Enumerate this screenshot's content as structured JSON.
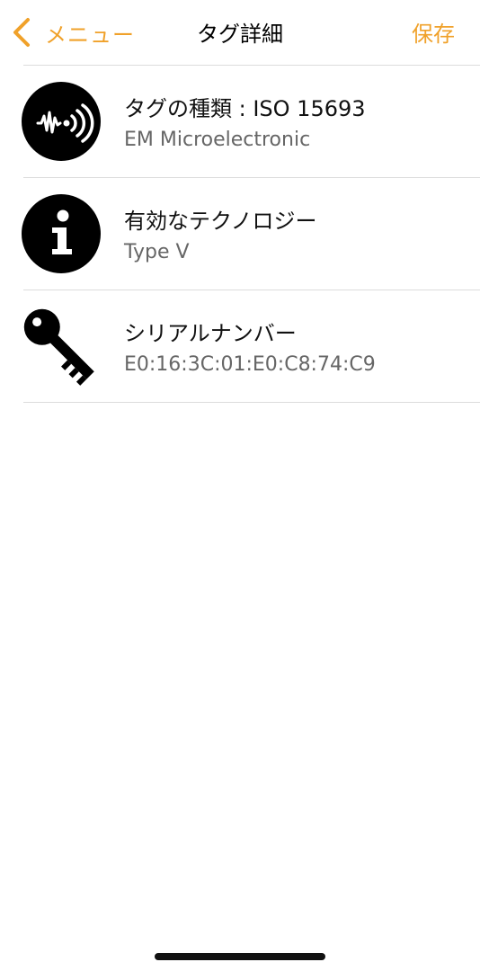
{
  "nav": {
    "back_label": "メニュー",
    "title": "タグ詳細",
    "save_label": "保存"
  },
  "rows": [
    {
      "icon": "nfc-signal-icon",
      "title": "タグの種類 : ISO 15693",
      "subtitle": "EM Microelectronic"
    },
    {
      "icon": "info-icon",
      "title": "有効なテクノロジー",
      "subtitle": "Type V"
    },
    {
      "icon": "key-icon",
      "title": "シリアルナンバー",
      "subtitle": "E0:16:3C:01:E0:C8:74:C9"
    }
  ],
  "colors": {
    "accent": "#F0A12A",
    "separator": "#dcdcdc",
    "subtitle": "#666666"
  }
}
